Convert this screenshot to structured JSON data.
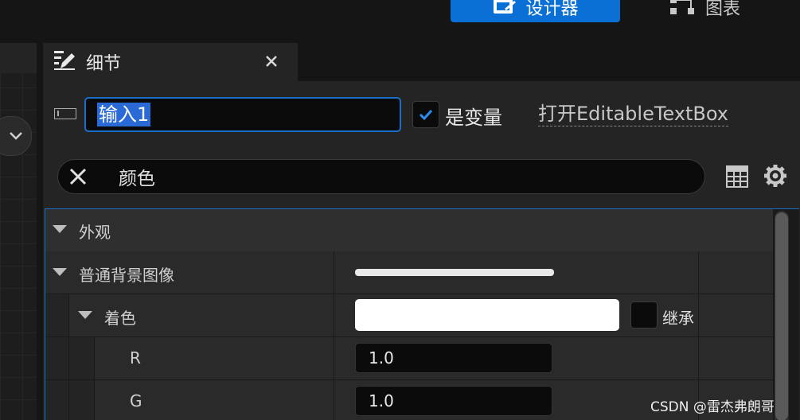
{
  "topbar": {
    "designer_label": "设计器",
    "graph_label": "图表"
  },
  "details": {
    "tab_title": "细节",
    "name_value": "输入1",
    "is_variable_label": "是变量",
    "is_variable_checked": true,
    "open_link": "打开EditableTextBox",
    "search_text": "颜色"
  },
  "tree": {
    "appearance": "外观",
    "normal_bg_image": "普通背景图像",
    "tint": "着色",
    "inherit_label": "继承",
    "r_label": "R",
    "r_value": "1.0",
    "g_label": "G",
    "g_value": "1.0"
  },
  "watermark": "CSDN @雷杰弗朗哥",
  "colors": {
    "accent": "#0a70d6",
    "panel": "#242424",
    "background": "#151515"
  }
}
